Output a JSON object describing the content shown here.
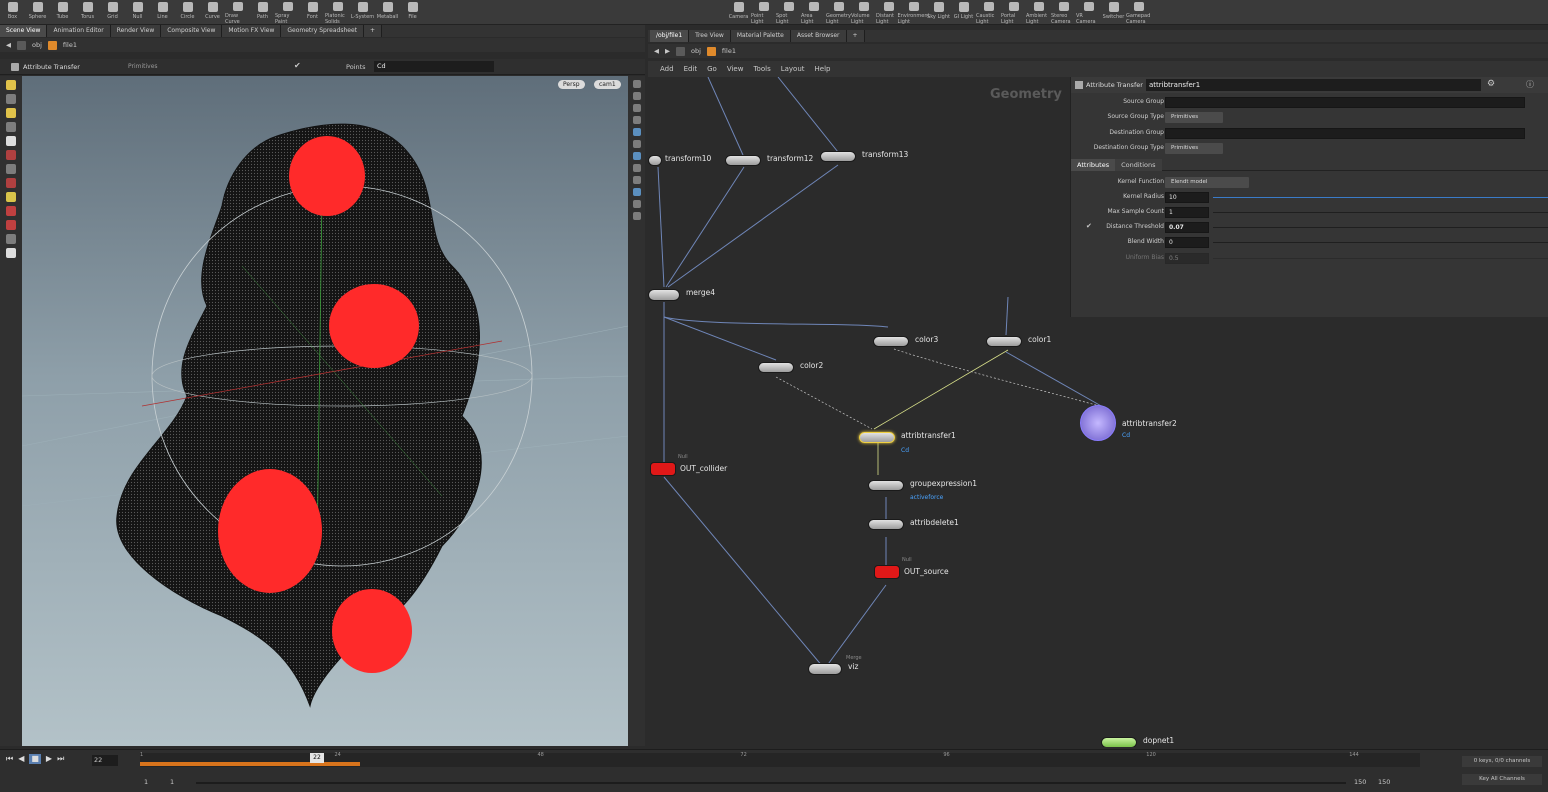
{
  "shelf_left": [
    {
      "label": "Box",
      "icon": "box-icon"
    },
    {
      "label": "Sphere",
      "icon": "sphere-icon"
    },
    {
      "label": "Tube",
      "icon": "tube-icon"
    },
    {
      "label": "Torus",
      "icon": "torus-icon"
    },
    {
      "label": "Grid",
      "icon": "grid-icon"
    },
    {
      "label": "Null",
      "icon": "null-icon"
    },
    {
      "label": "Line",
      "icon": "line-icon"
    },
    {
      "label": "Circle",
      "icon": "circle-icon"
    },
    {
      "label": "Curve",
      "icon": "curve-icon"
    },
    {
      "label": "Draw Curve",
      "icon": "draw-curve-icon"
    },
    {
      "label": "Path",
      "icon": "path-icon"
    },
    {
      "label": "Spray Paint",
      "icon": "spray-paint-icon"
    },
    {
      "label": "Font",
      "icon": "font-icon"
    },
    {
      "label": "Platonic Solids",
      "icon": "platonic-icon"
    },
    {
      "label": "L-System",
      "icon": "lsystem-icon"
    },
    {
      "label": "Metaball",
      "icon": "metaball-icon"
    },
    {
      "label": "File",
      "icon": "file-icon"
    }
  ],
  "shelf_right": [
    {
      "label": "Camera",
      "icon": "camera-icon"
    },
    {
      "label": "Point Light",
      "icon": "point-light-icon"
    },
    {
      "label": "Spot Light",
      "icon": "spot-light-icon"
    },
    {
      "label": "Area Light",
      "icon": "area-light-icon"
    },
    {
      "label": "Geometry Light",
      "icon": "geometry-light-icon"
    },
    {
      "label": "Volume Light",
      "icon": "volume-light-icon"
    },
    {
      "label": "Distant Light",
      "icon": "distant-light-icon"
    },
    {
      "label": "Environment Light",
      "icon": "environment-light-icon"
    },
    {
      "label": "Sky Light",
      "icon": "sky-light-icon"
    },
    {
      "label": "GI Light",
      "icon": "gi-light-icon"
    },
    {
      "label": "Caustic Light",
      "icon": "caustic-light-icon"
    },
    {
      "label": "Portal Light",
      "icon": "portal-light-icon"
    },
    {
      "label": "Ambient Light",
      "icon": "ambient-light-icon"
    },
    {
      "label": "Stereo Camera",
      "icon": "stereo-camera-icon"
    },
    {
      "label": "VR Camera",
      "icon": "vr-camera-icon"
    },
    {
      "label": "Switcher",
      "icon": "switcher-icon"
    },
    {
      "label": "Gamepad Camera",
      "icon": "gamepad-camera-icon"
    }
  ],
  "left_tabs": [
    "Scene View",
    "Animation Editor",
    "Render View",
    "Composite View",
    "Motion FX View",
    "Geometry Spreadsheet"
  ],
  "right_tabs": [
    "/obj/file1",
    "Tree View",
    "Material Palette",
    "Asset Browser"
  ],
  "left_path": {
    "obj": "obj",
    "file": "file1"
  },
  "right_path": {
    "obj": "obj",
    "file": "file1"
  },
  "viewport_toolbar": {
    "tool": "Attribute Transfer",
    "group_type": "Primitives",
    "points_label": "Points",
    "points_value": "Cd"
  },
  "viewport": {
    "persp": "Persp",
    "cam": "cam1"
  },
  "network_menu": [
    "Add",
    "Edit",
    "Go",
    "View",
    "Tools",
    "Layout",
    "Help"
  ],
  "network_watermark": "Geometry",
  "params": {
    "node_type": "Attribute Transfer",
    "node_name": "attribtransfer1",
    "source_group_label": "Source Group",
    "source_group_type_label": "Source Group Type",
    "source_group_type_value": "Primitives",
    "dest_group_label": "Destination Group",
    "dest_group_type_label": "Destination Group Type",
    "dest_group_type_value": "Primitives",
    "tabs": [
      "Attributes",
      "Conditions"
    ],
    "kernel_function_label": "Kernel Function",
    "kernel_function_value": "Elendt model",
    "kernel_radius_label": "Kernel Radius",
    "kernel_radius_value": "10",
    "max_sample_label": "Max Sample Count",
    "max_sample_value": "1",
    "distance_threshold_label": "Distance Threshold",
    "distance_threshold_value": "0.07",
    "blend_width_label": "Blend Width",
    "blend_width_value": "0",
    "uniform_bias_label": "Uniform Bias",
    "uniform_bias_value": "0.5"
  },
  "nodes": {
    "transform10": "transform10",
    "transform12": "transform12",
    "transform13": "transform13",
    "merge4": "merge4",
    "color3": "color3",
    "color1": "color1",
    "color2": "color2",
    "attribtransfer1": "attribtransfer1",
    "attribtransfer1_sub": "Cd",
    "attribtransfer2": "attribtransfer2",
    "attribtransfer2_sub": "Cd",
    "out_collider_type": "Null",
    "out_collider": "OUT_collider",
    "groupexpression1": "groupexpression1",
    "groupexpression1_sub": "activeforce",
    "attribdelete1": "attribdelete1",
    "out_source_type": "Null",
    "out_source": "OUT_source",
    "viz_type": "Merge",
    "viz": "viz",
    "dopnet1": "dopnet1"
  },
  "timeline": {
    "current_frame": "22",
    "ticks": [
      "1",
      "24",
      "48",
      "72",
      "96",
      "120",
      "144"
    ],
    "range_start": "1",
    "range_start2": "1",
    "range_end": "150",
    "range_end2": "150",
    "keys_info": "0 keys, 0/0 channels",
    "key_all_channels": "Key All Channels"
  }
}
